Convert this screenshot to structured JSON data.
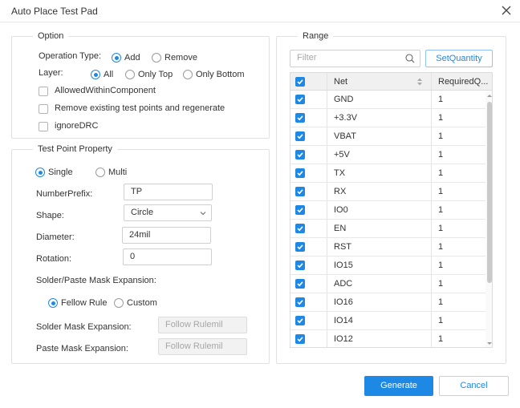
{
  "window": {
    "title": "Auto Place Test Pad"
  },
  "option": {
    "legend": "Option",
    "operation_type_label": "Operation Type:",
    "operation_add": "Add",
    "operation_remove": "Remove",
    "operation_selected": "Add",
    "layer_label": "Layer:",
    "layer_all": "All",
    "layer_top": "Only Top",
    "layer_bottom": "Only Bottom",
    "layer_selected": "All",
    "allowed_within_component": "AllowedWithinComponent",
    "remove_existing": "Remove existing test points and regenerate",
    "ignore_drc": "ignoreDRC"
  },
  "test_point": {
    "legend": "Test Point Property",
    "single": "Single",
    "multi": "Multi",
    "mode_selected": "Single",
    "number_prefix_label": "NumberPrefix:",
    "number_prefix_value": "TP",
    "shape_label": "Shape:",
    "shape_value": "Circle",
    "diameter_label": "Diameter:",
    "diameter_value": "24mil",
    "rotation_label": "Rotation:",
    "rotation_value": "0",
    "mask_expansion_label": "Solder/Paste Mask Expansion:",
    "fellow_rule": "Fellow Rule",
    "custom": "Custom",
    "mask_mode_selected": "Fellow Rule",
    "solder_mask_label": "Solder Mask Expansion:",
    "solder_mask_placeholder": "Follow Rulemil",
    "paste_mask_label": "Paste Mask Expansion:",
    "paste_mask_placeholder": "Follow Rulemil"
  },
  "range": {
    "legend": "Range",
    "filter_placeholder": "Filter",
    "set_quantity": "SetQuantity",
    "columns": {
      "net": "Net",
      "required": "RequiredQ..."
    },
    "rows": [
      {
        "net": "GND",
        "qty": "1"
      },
      {
        "net": "+3.3V",
        "qty": "1"
      },
      {
        "net": "VBAT",
        "qty": "1"
      },
      {
        "net": "+5V",
        "qty": "1"
      },
      {
        "net": "TX",
        "qty": "1"
      },
      {
        "net": "RX",
        "qty": "1"
      },
      {
        "net": "IO0",
        "qty": "1"
      },
      {
        "net": "EN",
        "qty": "1"
      },
      {
        "net": "RST",
        "qty": "1"
      },
      {
        "net": "IO15",
        "qty": "1"
      },
      {
        "net": "ADC",
        "qty": "1"
      },
      {
        "net": "IO16",
        "qty": "1"
      },
      {
        "net": "IO14",
        "qty": "1"
      },
      {
        "net": "IO12",
        "qty": "1"
      }
    ]
  },
  "footer": {
    "generate": "Generate",
    "cancel": "Cancel"
  },
  "colors": {
    "accent": "#1e88e5",
    "border": "#e1e1e1"
  }
}
